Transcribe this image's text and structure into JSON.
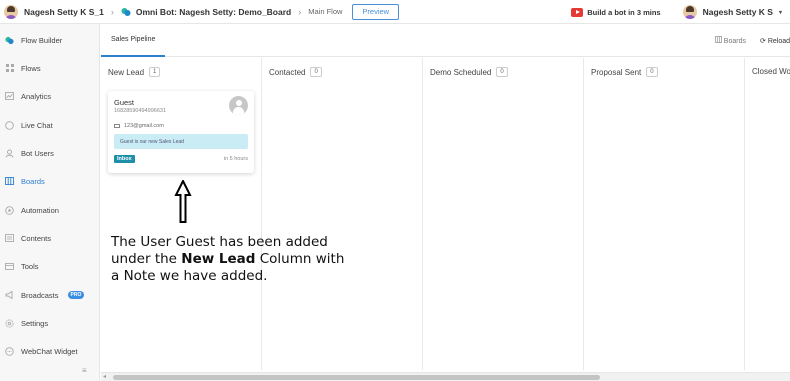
{
  "topbar": {
    "user": "Nagesh Setty K S_1",
    "bot": "Omni Bot: Nagesh Setty: Demo_Board",
    "flow": "Main Flow",
    "preview_label": "Preview",
    "youtube_label": "Build a bot in 3 mins",
    "account_name": "Nagesh Setty K S",
    "account_caret": "▾"
  },
  "sidebar": {
    "items": [
      {
        "label": "Flow Builder",
        "icon": "flow-builder-icon"
      },
      {
        "label": "Flows",
        "icon": "flows-icon"
      },
      {
        "label": "Analytics",
        "icon": "analytics-icon"
      },
      {
        "label": "Live Chat",
        "icon": "live-chat-icon"
      },
      {
        "label": "Bot Users",
        "icon": "bot-users-icon"
      },
      {
        "label": "Boards",
        "icon": "boards-icon"
      },
      {
        "label": "Automation",
        "icon": "automation-icon"
      },
      {
        "label": "Contents",
        "icon": "contents-icon"
      },
      {
        "label": "Tools",
        "icon": "tools-icon"
      },
      {
        "label": "Broadcasts",
        "icon": "broadcasts-icon",
        "badge": "PRO"
      },
      {
        "label": "Settings",
        "icon": "settings-icon"
      },
      {
        "label": "WebChat Widget",
        "icon": "webchat-widget-icon"
      }
    ],
    "active": "Boards",
    "collapse_glyph": "≡"
  },
  "main": {
    "tab": "Sales Pipeline",
    "boards_label": "Boards",
    "reload_label": "Reload",
    "columns": [
      {
        "title": "New Lead",
        "count": "1"
      },
      {
        "title": "Contacted",
        "count": "0"
      },
      {
        "title": "Demo Scheduled",
        "count": "0"
      },
      {
        "title": "Proposal Sent",
        "count": "0"
      },
      {
        "title": "Closed Won",
        "count": ""
      }
    ],
    "card": {
      "name": "Guest",
      "phone": "16828590494996631",
      "email": "123@gmail.com",
      "note": "Guest is our new Sales Lead",
      "tag": "Inbox",
      "time": "in 5 hours"
    }
  },
  "annotation": {
    "line1": "The User Guest has been added",
    "line2a": "under the ",
    "line2b": "New Lead",
    "line2c": " Column with",
    "line3": "a Note we have added."
  },
  "colors": {
    "accent": "#2f7fd1",
    "note_bg": "#c9ecf5",
    "inbox_tag": "#1f8fa8",
    "youtube": "#e53935"
  }
}
